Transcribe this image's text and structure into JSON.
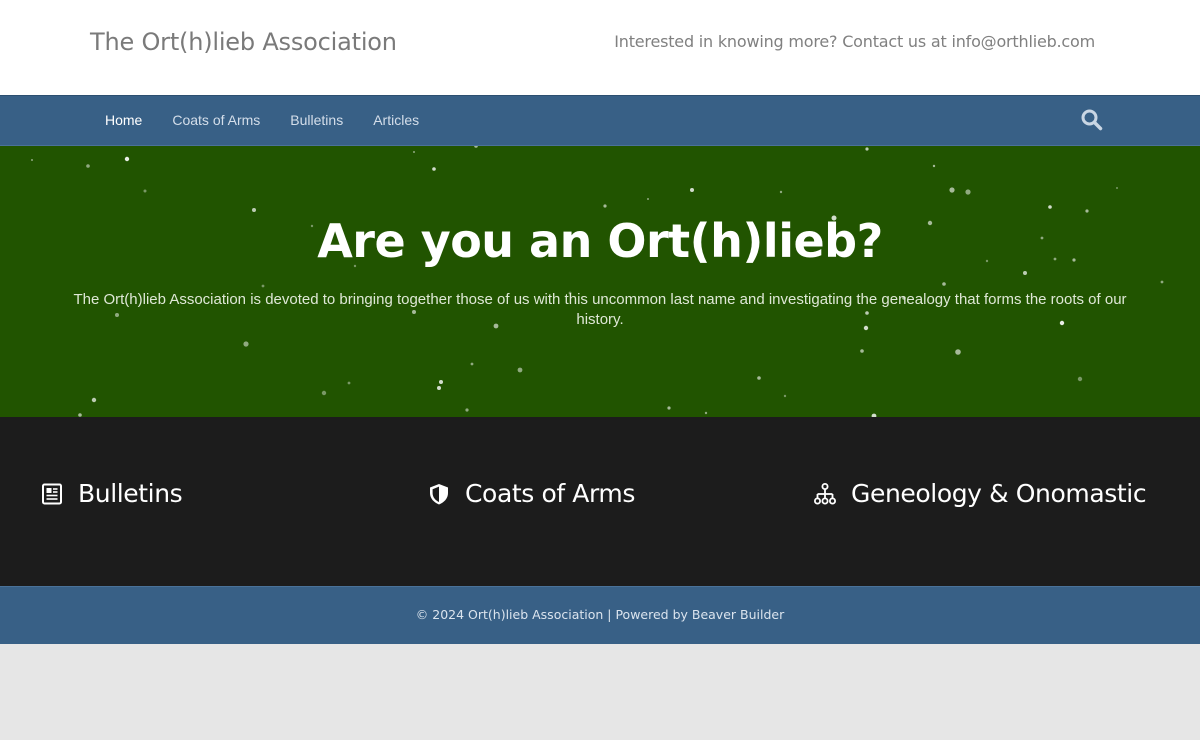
{
  "header": {
    "site_title": "The Ort(h)lieb Association",
    "contact_text": "Interested in knowing more? Contact us at info@orthlieb.com"
  },
  "nav": {
    "items": [
      {
        "label": "Home",
        "active": true
      },
      {
        "label": "Coats of Arms",
        "active": false
      },
      {
        "label": "Bulletins",
        "active": false
      },
      {
        "label": "Articles",
        "active": false
      }
    ],
    "search_icon": "search-icon"
  },
  "hero": {
    "title": "Are you an Ort(h)lieb?",
    "text": "The Ort(h)lieb Association is devoted to bringing together those of us with this uncommon last name and investigating the genealogy that forms the roots of our history.",
    "background_color": "#215400"
  },
  "features": [
    {
      "label": "Bulletins",
      "icon": "newspaper-icon"
    },
    {
      "label": "Coats of Arms",
      "icon": "shield-icon"
    },
    {
      "label": "Geneology & Onomastic",
      "icon": "sitemap-icon"
    }
  ],
  "footer": {
    "text": "© 2024 Ort(h)lieb Association | Powered by Beaver Builder"
  },
  "colors": {
    "nav_bg": "#386086",
    "features_bg": "#1c1c1c",
    "page_bg": "#e6e6e6"
  }
}
